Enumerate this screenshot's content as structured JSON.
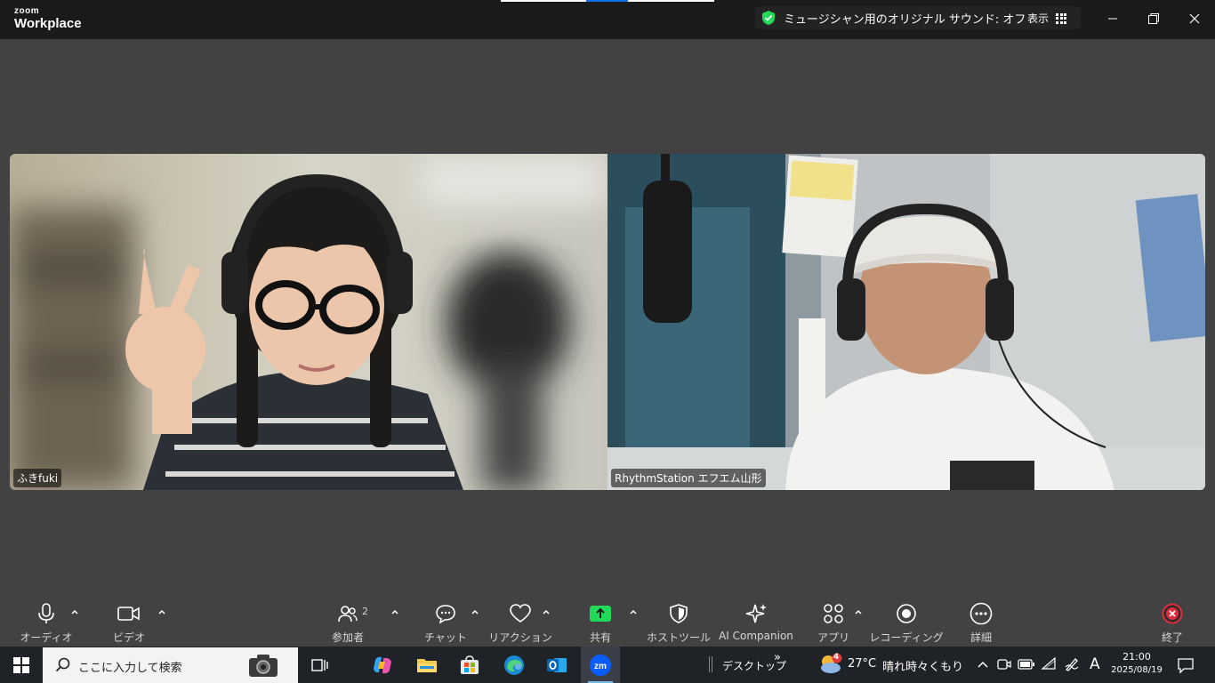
{
  "titlebar": {
    "logo_top": "zoom",
    "logo_bottom": "Workplace",
    "original_sound_label": "ミュージシャン用のオリジナル サウンド: オフ",
    "view_label": "表示"
  },
  "participants": [
    {
      "name": "ふきfuki"
    },
    {
      "name": "RhythmStation エフエム山形"
    }
  ],
  "toolbar": {
    "audio_label": "オーディオ",
    "video_label": "ビデオ",
    "participants_label": "参加者",
    "participants_count": "2",
    "chat_label": "チャット",
    "reactions_label": "リアクション",
    "share_label": "共有",
    "host_tools_label": "ホストツール",
    "ai_companion_label": "AI Companion",
    "apps_label": "アプリ",
    "recording_label": "レコーディング",
    "more_label": "詳細",
    "end_label": "終了",
    "colors": {
      "share": "#23d959",
      "end": "#e02d3c"
    }
  },
  "taskbar": {
    "search_placeholder": "ここに入力して検索",
    "desktop_label": "デスクトップ",
    "desktop_chevron": "»",
    "weather_temp": "27°C",
    "weather_desc": "晴れ時々くもり",
    "weather_badge": "4",
    "ime_indicator": "A",
    "time": "21:00",
    "date": "2025/08/19"
  }
}
